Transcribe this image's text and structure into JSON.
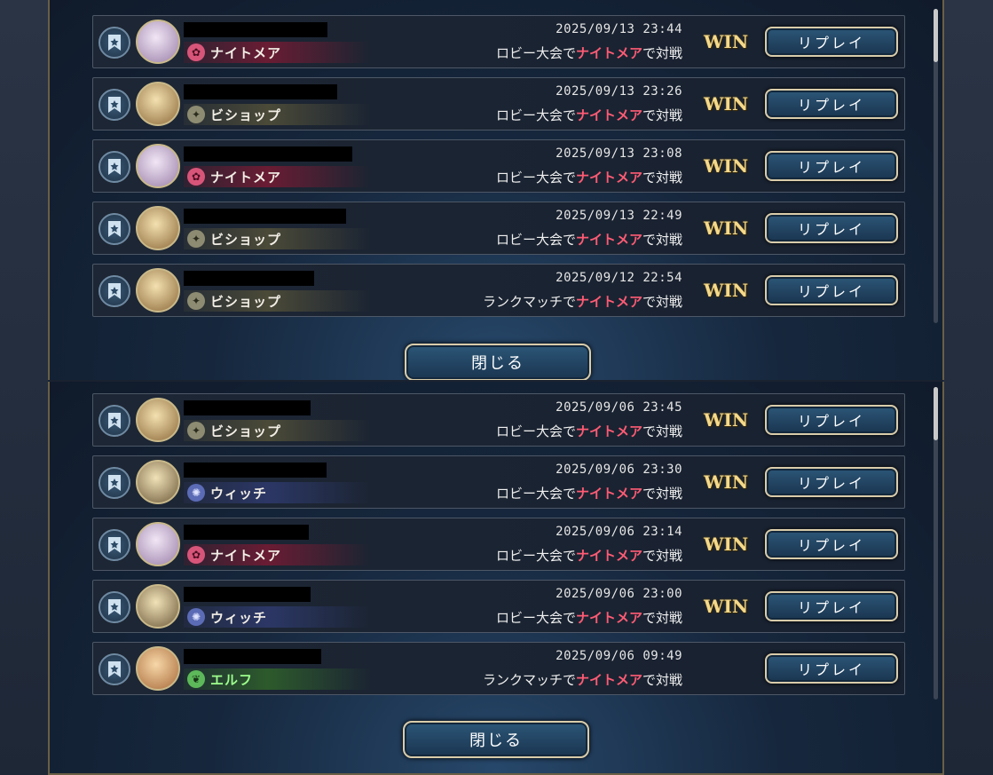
{
  "panels": [
    {
      "rows": [
        {
          "class_key": "nightmare",
          "class_name": "ナイトメア",
          "datetime": "2025/09/13 23:44",
          "mode": "ロビー大会",
          "deck": "ナイトメア",
          "suffix": "で対戦",
          "result": "WIN",
          "replay": "リプレイ"
        },
        {
          "class_key": "bishop",
          "class_name": "ビショップ",
          "datetime": "2025/09/13 23:26",
          "mode": "ロビー大会",
          "deck": "ナイトメア",
          "suffix": "で対戦",
          "result": "WIN",
          "replay": "リプレイ"
        },
        {
          "class_key": "nightmare",
          "class_name": "ナイトメア",
          "datetime": "2025/09/13 23:08",
          "mode": "ロビー大会",
          "deck": "ナイトメア",
          "suffix": "で対戦",
          "result": "WIN",
          "replay": "リプレイ"
        },
        {
          "class_key": "bishop",
          "class_name": "ビショップ",
          "datetime": "2025/09/13 22:49",
          "mode": "ロビー大会",
          "deck": "ナイトメア",
          "suffix": "で対戦",
          "result": "WIN",
          "replay": "リプレイ"
        },
        {
          "class_key": "bishop",
          "class_name": "ビショップ",
          "datetime": "2025/09/12 22:54",
          "mode": "ランクマッチ",
          "deck": "ナイトメア",
          "suffix": "で対戦",
          "result": "WIN",
          "replay": "リプレイ"
        }
      ],
      "close_label": "閉じる"
    },
    {
      "rows": [
        {
          "class_key": "bishop",
          "class_name": "ビショップ",
          "datetime": "2025/09/06 23:45",
          "mode": "ロビー大会",
          "deck": "ナイトメア",
          "suffix": "で対戦",
          "result": "WIN",
          "replay": "リプレイ"
        },
        {
          "class_key": "witch",
          "class_name": "ウィッチ",
          "datetime": "2025/09/06 23:30",
          "mode": "ロビー大会",
          "deck": "ナイトメア",
          "suffix": "で対戦",
          "result": "WIN",
          "replay": "リプレイ"
        },
        {
          "class_key": "nightmare",
          "class_name": "ナイトメア",
          "datetime": "2025/09/06 23:14",
          "mode": "ロビー大会",
          "deck": "ナイトメア",
          "suffix": "で対戦",
          "result": "WIN",
          "replay": "リプレイ"
        },
        {
          "class_key": "witch",
          "class_name": "ウィッチ",
          "datetime": "2025/09/06 23:00",
          "mode": "ロビー大会",
          "deck": "ナイトメア",
          "suffix": "で対戦",
          "result": "WIN",
          "replay": "リプレイ"
        },
        {
          "class_key": "elf",
          "class_name": "エルフ",
          "datetime": "2025/09/06 09:49",
          "mode": "ランクマッチ",
          "deck": "ナイトメア",
          "suffix": "で対戦",
          "result": "",
          "replay": "リプレイ"
        }
      ],
      "close_label": "閉じる"
    }
  ],
  "colors": {
    "highlight": "#ff5b74",
    "win": "#f5d98a",
    "nightmare": "#d8557a",
    "bishop": "#8d8c72",
    "witch": "#5b6bb5",
    "elf": "#5db85a"
  }
}
